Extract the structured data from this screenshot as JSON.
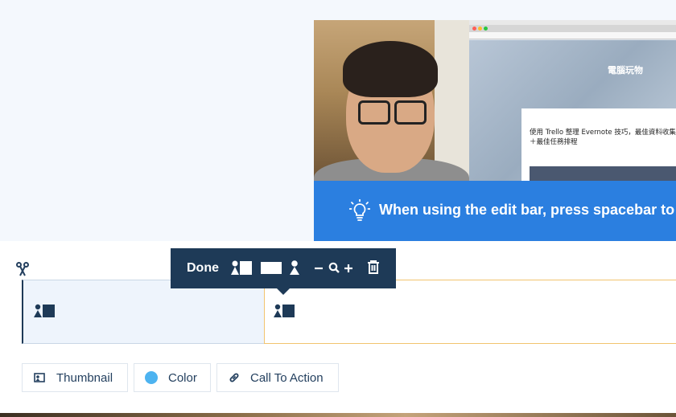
{
  "preview": {
    "tip_text": "When using the edit bar, press spacebar to play",
    "browser": {
      "site_title": "電腦玩物",
      "card_title": "使用 Trello 整理 Evernote 技巧，最佳資料收集＋最佳任務排程"
    }
  },
  "editbar": {
    "done_label": "Done",
    "buttons": [
      "thumbnail-layout-icon",
      "full-rectangle-icon",
      "person-icon",
      "minus-icon",
      "zoom-icon",
      "plus-icon",
      "trash-icon"
    ]
  },
  "timeline": {
    "clips": [
      {
        "icon": "thumbnail-layout-icon",
        "selected": true
      },
      {
        "icon": "thumbnail-layout-icon",
        "selected": false
      }
    ]
  },
  "toolbar": {
    "thumbnail_label": "Thumbnail",
    "color_label": "Color",
    "cta_label": "Call To Action"
  },
  "colors": {
    "navy": "#1e3a57",
    "accent_blue": "#2b7fe0",
    "color_dot": "#4db3f0",
    "clip_border": "#f2c46f"
  }
}
